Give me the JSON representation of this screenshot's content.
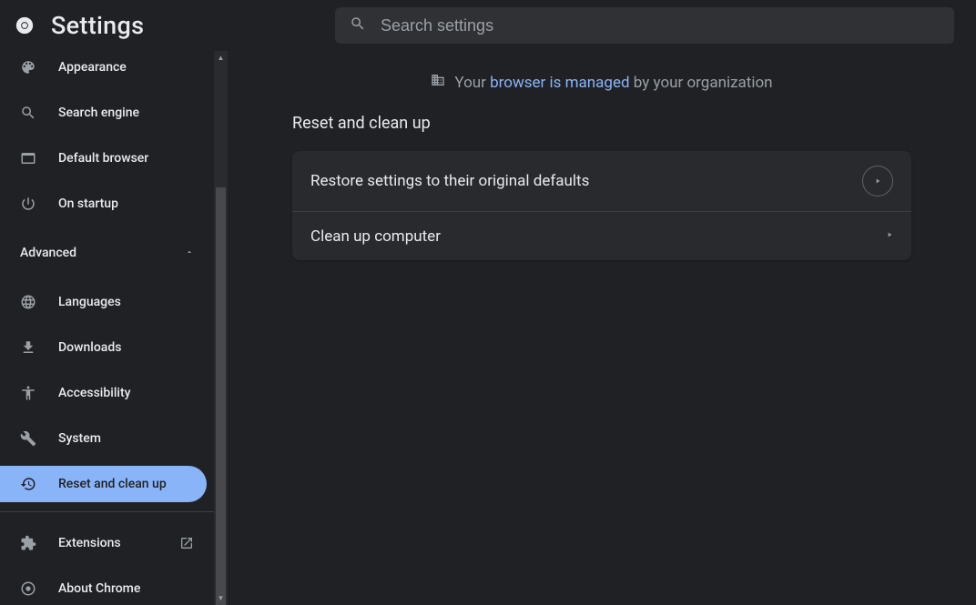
{
  "header": {
    "title": "Settings",
    "search_placeholder": "Search settings"
  },
  "sidebar": {
    "items_top": [
      {
        "icon": "palette",
        "label": "Appearance"
      },
      {
        "icon": "search",
        "label": "Search engine"
      },
      {
        "icon": "browser",
        "label": "Default browser"
      },
      {
        "icon": "power",
        "label": "On startup"
      }
    ],
    "advanced_label": "Advanced",
    "items_advanced": [
      {
        "icon": "globe",
        "label": "Languages"
      },
      {
        "icon": "download",
        "label": "Downloads"
      },
      {
        "icon": "accessibility",
        "label": "Accessibility"
      },
      {
        "icon": "wrench",
        "label": "System"
      },
      {
        "icon": "restore",
        "label": "Reset and clean up",
        "selected": true
      }
    ],
    "items_bottom": [
      {
        "icon": "extension",
        "label": "Extensions",
        "external": true
      },
      {
        "icon": "chrome",
        "label": "About Chrome"
      }
    ]
  },
  "managed": {
    "prefix": "Your ",
    "link": "browser is managed",
    "suffix": " by your organization"
  },
  "main": {
    "section_title": "Reset and clean up",
    "rows": [
      {
        "label": "Restore settings to their original defaults",
        "style": "circle"
      },
      {
        "label": "Clean up computer",
        "style": "arrow"
      }
    ]
  }
}
